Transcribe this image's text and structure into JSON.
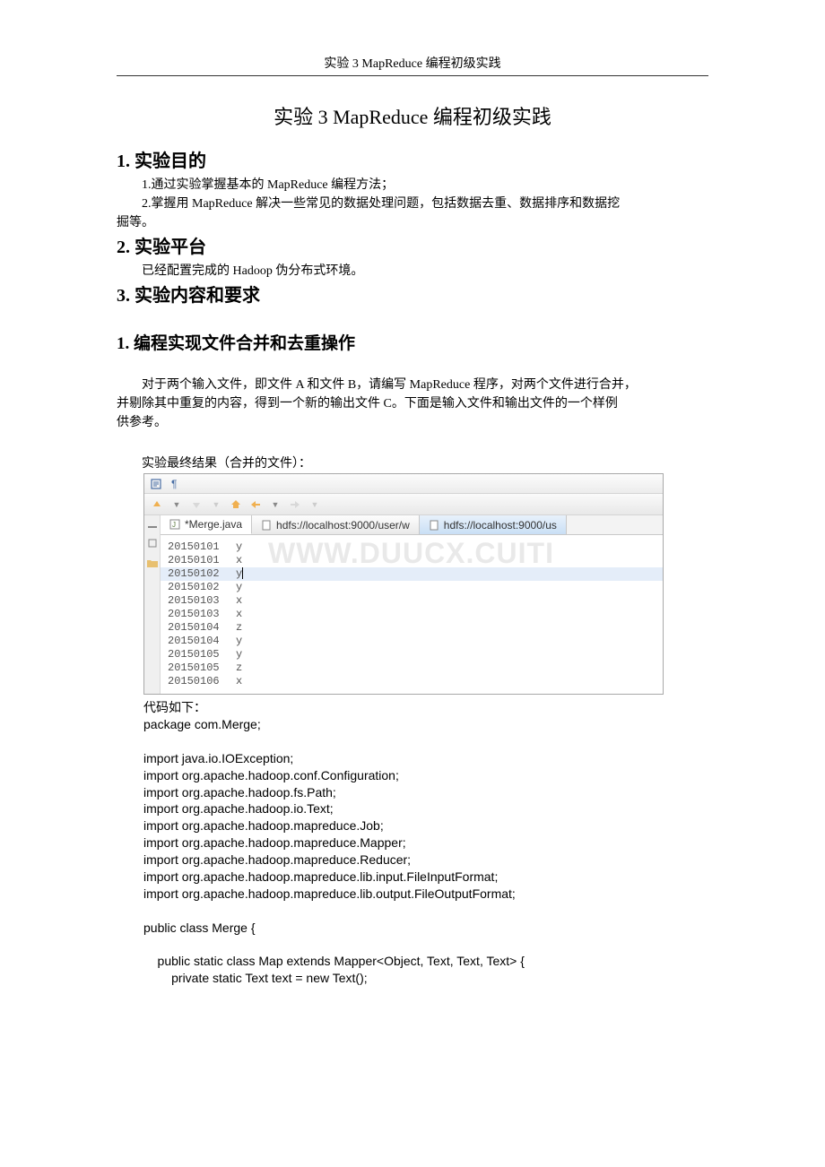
{
  "header": "实验 3 MapReduce 编程初级实践",
  "title": "实验 3 MapReduce 编程初级实践",
  "section1": {
    "heading": "1.  实验目的",
    "line1": "1.通过实验掌握基本的 MapReduce 编程方法；",
    "line2": "2.掌握用 MapReduce 解决一些常见的数据处理问题，包括数据去重、数据排序和数据挖",
    "line3": "掘等。"
  },
  "section2": {
    "heading": "2.  实验平台",
    "line1": "已经配置完成的 Hadoop 伪分布式环境。"
  },
  "section3": {
    "heading": "3.  实验内容和要求"
  },
  "sub1": {
    "heading": "1. 编程实现文件合并和去重操作",
    "para_l1": "对于两个输入文件，即文件 A 和文件 B，请编写 MapReduce 程序，对两个文件进行合并，",
    "para_l2": "并剔除其中重复的内容，得到一个新的输出文件 C。下面是输入文件和输出文件的一个样例",
    "para_l3": "供参考。"
  },
  "result_label": "实验最终结果（合并的文件）：",
  "ide": {
    "tabs": {
      "t1": "*Merge.java",
      "t2": "hdfs://localhost:9000/user/w",
      "t3": "hdfs://localhost:9000/us"
    },
    "watermark": "WWW.DUUCX.CUITI",
    "data_rows": [
      {
        "date": "20150101",
        "val": "y"
      },
      {
        "date": "20150101",
        "val": "x"
      },
      {
        "date": "20150102",
        "val": "y"
      },
      {
        "date": "20150102",
        "val": "y"
      },
      {
        "date": "20150103",
        "val": "x"
      },
      {
        "date": "20150103",
        "val": "x"
      },
      {
        "date": "20150104",
        "val": "z"
      },
      {
        "date": "20150104",
        "val": "y"
      },
      {
        "date": "20150105",
        "val": "y"
      },
      {
        "date": "20150105",
        "val": "z"
      },
      {
        "date": "20150106",
        "val": "x"
      }
    ]
  },
  "code_label": "代码如下：",
  "code_lines": {
    "l1": "package com.Merge;",
    "l2": "",
    "l3": "import java.io.IOException;",
    "l4": "import org.apache.hadoop.conf.Configuration;",
    "l5": "import org.apache.hadoop.fs.Path;",
    "l6": "import org.apache.hadoop.io.Text;",
    "l7": "import org.apache.hadoop.mapreduce.Job;",
    "l8": "import org.apache.hadoop.mapreduce.Mapper;",
    "l9": "import org.apache.hadoop.mapreduce.Reducer;",
    "l10": "import org.apache.hadoop.mapreduce.lib.input.FileInputFormat;",
    "l11": "import org.apache.hadoop.mapreduce.lib.output.FileOutputFormat;",
    "l12": "",
    "l13": "public class Merge {",
    "l14": "",
    "l15": "    public static class Map extends Mapper<Object, Text, Text, Text> {",
    "l16": "        private static Text text = new Text();"
  }
}
